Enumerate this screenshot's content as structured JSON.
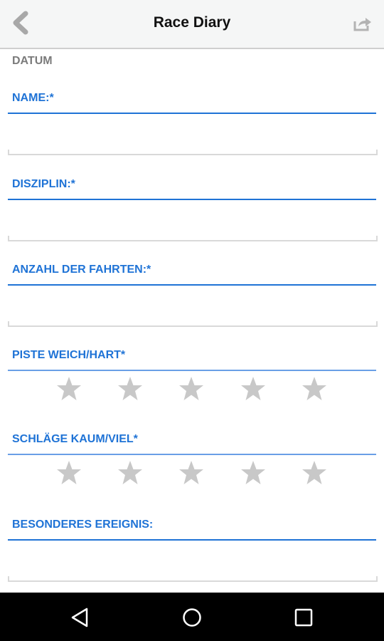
{
  "header": {
    "title": "Race Diary",
    "back_icon": "chevron-left-icon",
    "share_icon": "share-icon"
  },
  "form": {
    "datum_label": "DATUM",
    "name": {
      "label": "NAME:*",
      "value": ""
    },
    "disziplin": {
      "label": "DISZIPLIN:*",
      "value": ""
    },
    "anzahl": {
      "label": "ANZAHL DER FAHRTEN:*",
      "value": ""
    },
    "piste": {
      "label": "PISTE WEICH/HART*",
      "rating": 0,
      "max": 5
    },
    "schlaege": {
      "label": "SCHLÄGE KAUM/VIEL*",
      "rating": 0,
      "max": 5
    },
    "ereignis": {
      "label": "BESONDERES EREIGNIS:",
      "value": ""
    }
  },
  "colors": {
    "accent": "#1f73d6",
    "star_empty": "#c8c8c8",
    "label_gray": "#7b7b7b"
  },
  "navbar": {
    "back": "nav-back-icon",
    "home": "nav-home-icon",
    "recents": "nav-recents-icon"
  }
}
